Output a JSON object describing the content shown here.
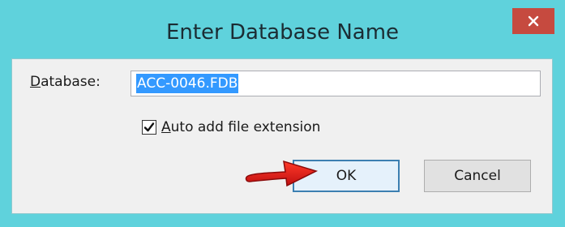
{
  "dialog": {
    "title": "Enter Database Name",
    "close_icon": "close-x-icon",
    "close_color": "#c64a3f",
    "frame_color": "#5fd2dc"
  },
  "form": {
    "database_label_mnemonic": "D",
    "database_label_rest": "atabase:",
    "database_value": "ACC-0046.FDB",
    "auto_ext_checked": true,
    "auto_ext_label_mnemonic": "A",
    "auto_ext_label_rest": "uto add file extension"
  },
  "buttons": {
    "ok_label": "OK",
    "cancel_label": "Cancel"
  },
  "annotation": {
    "arrow_icon": "red-arrow-icon",
    "arrow_color": "#e02020"
  }
}
